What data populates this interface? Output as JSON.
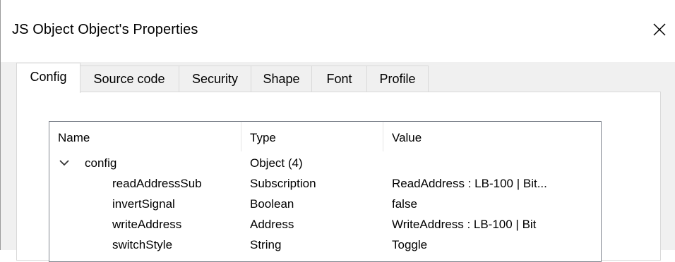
{
  "window": {
    "title": "JS Object Object's Properties"
  },
  "tabs": [
    {
      "label": "Config"
    },
    {
      "label": "Source code"
    },
    {
      "label": "Security"
    },
    {
      "label": "Shape"
    },
    {
      "label": "Font"
    },
    {
      "label": "Profile"
    }
  ],
  "list": {
    "columns": [
      "Name",
      "Type",
      "Value"
    ],
    "rows": [
      {
        "name": "config",
        "type": "Object (4)",
        "value": "",
        "expanded": true
      },
      {
        "name": "readAddressSub",
        "type": "Subscription",
        "value": "ReadAddress : LB-100 | Bit..."
      },
      {
        "name": "invertSignal",
        "type": "Boolean",
        "value": "false"
      },
      {
        "name": "writeAddress",
        "type": "Address",
        "value": "WriteAddress : LB-100 | Bit"
      },
      {
        "name": "switchStyle",
        "type": "String",
        "value": "Toggle"
      }
    ]
  }
}
